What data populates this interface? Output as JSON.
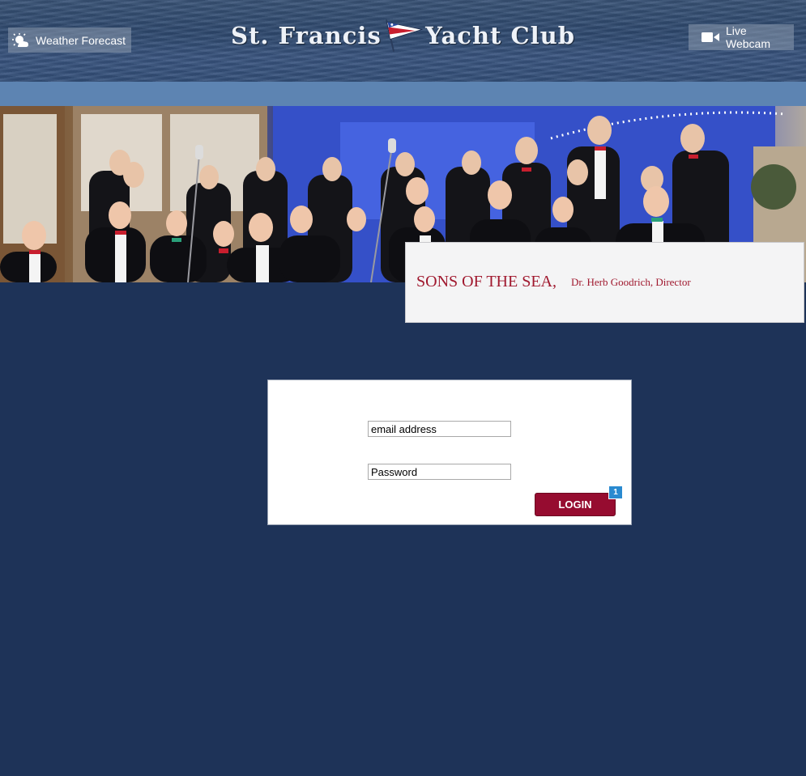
{
  "header": {
    "weather_label": "Weather Forecast",
    "webcam_label": "Live Webcam",
    "logo_left": "St. Francis",
    "logo_right": "Yacht Club"
  },
  "feature": {
    "title": "SONS OF THE SEA,",
    "subtitle": "Dr. Herb Goodrich, Director"
  },
  "login": {
    "email_placeholder": "email address",
    "password_placeholder": "Password",
    "button_label": "LOGIN",
    "badge_count": "1"
  },
  "colors": {
    "background": "#1e3358",
    "accent_bar": "#5d84b2",
    "brand_red": "#960c30",
    "badge_blue": "#2a8ad0"
  },
  "icons": {
    "weather": "sun-cloud-icon",
    "webcam": "video-camera-icon"
  }
}
